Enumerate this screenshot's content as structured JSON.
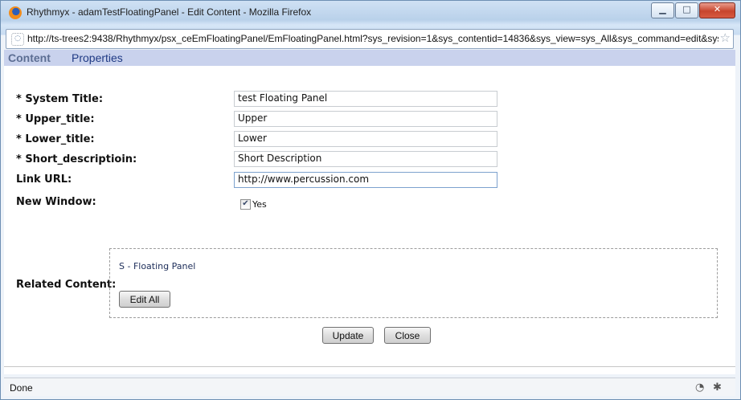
{
  "window": {
    "title": "Rhythmyx - adamTestFloatingPanel - Edit Content - Mozilla Firefox",
    "url": "http://ts-trees2:9438/Rhythmyx/psx_ceEmFloatingPanel/EmFloatingPanel.html?sys_revision=1&sys_contentid=14836&sys_view=sys_All&sys_command=edit&sys",
    "controls": {
      "minimize": "▁",
      "maximize": "□",
      "close": "✕"
    }
  },
  "tabs": {
    "content": "Content",
    "properties": "Properties"
  },
  "form": {
    "system_title": {
      "label": "* System Title:",
      "value": "test Floating Panel"
    },
    "upper_title": {
      "label": "* Upper_title:",
      "value": "Upper"
    },
    "lower_title": {
      "label": "* Lower_title:",
      "value": "Lower"
    },
    "short_description": {
      "label": "* Short_descriptioin:",
      "value": "Short Description"
    },
    "link_url": {
      "label": "Link URL:",
      "value": "http://www.percussion.com"
    },
    "new_window": {
      "label": "New Window:",
      "option": "Yes",
      "checked": true
    }
  },
  "related": {
    "label": "Related Content:",
    "items": [
      "S - Floating Panel"
    ],
    "edit_all": "Edit All"
  },
  "actions": {
    "update": "Update",
    "close": "Close"
  },
  "status": {
    "text": "Done"
  },
  "icons": {
    "app": "firefox-icon",
    "page": "page-icon",
    "bookmark": "star-icon",
    "feed": "rss-feed-icon",
    "addon": "bug-icon"
  }
}
